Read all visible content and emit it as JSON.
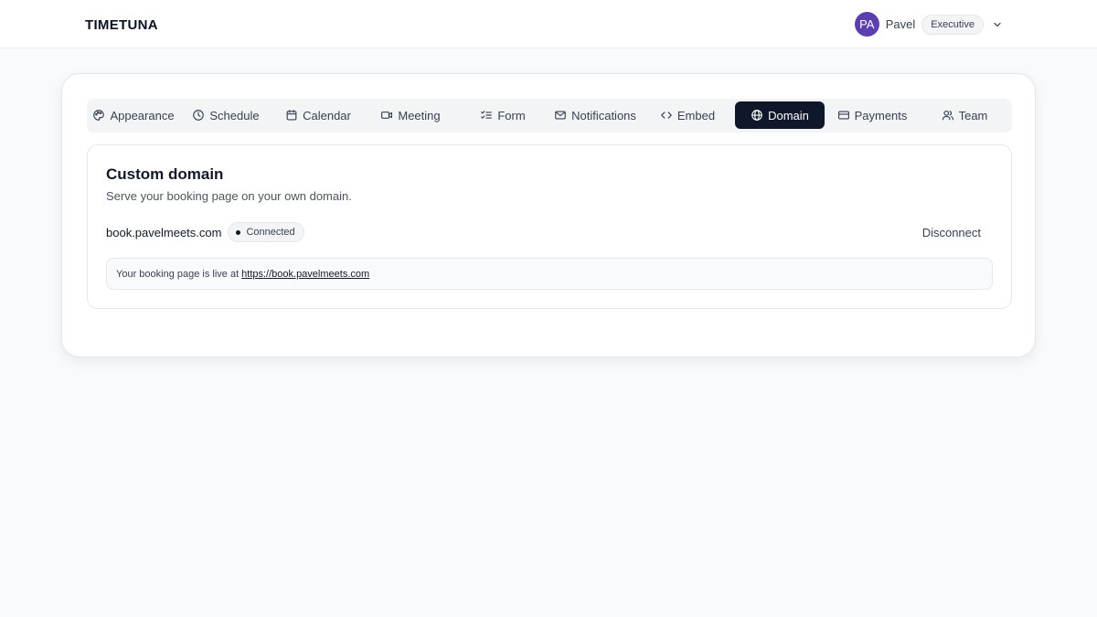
{
  "app": {
    "logo": "TIMETUNA"
  },
  "user": {
    "initials": "PA",
    "name": "Pavel",
    "plan": "Executive"
  },
  "tabs": [
    {
      "label": "Appearance",
      "icon": "palette-icon"
    },
    {
      "label": "Schedule",
      "icon": "clock-icon"
    },
    {
      "label": "Calendar",
      "icon": "calendar-icon"
    },
    {
      "label": "Meeting",
      "icon": "video-icon"
    },
    {
      "label": "Form",
      "icon": "checklist-icon"
    },
    {
      "label": "Notifications",
      "icon": "mail-icon"
    },
    {
      "label": "Embed",
      "icon": "code-icon"
    },
    {
      "label": "Domain",
      "icon": "globe-icon",
      "active": true
    },
    {
      "label": "Payments",
      "icon": "credit-card-icon"
    },
    {
      "label": "Team",
      "icon": "users-icon"
    }
  ],
  "domain": {
    "title": "Custom domain",
    "description": "Serve your booking page on your own domain.",
    "name": "book.pavelmeets.com",
    "status": "Connected",
    "disconnect_label": "Disconnect",
    "live_text": "Your booking page is live at",
    "live_url": "https://book.pavelmeets.com"
  },
  "colors": {
    "active_tab": "#0f172a",
    "avatar": "#5b3fb0",
    "background": "#f9fafb"
  }
}
